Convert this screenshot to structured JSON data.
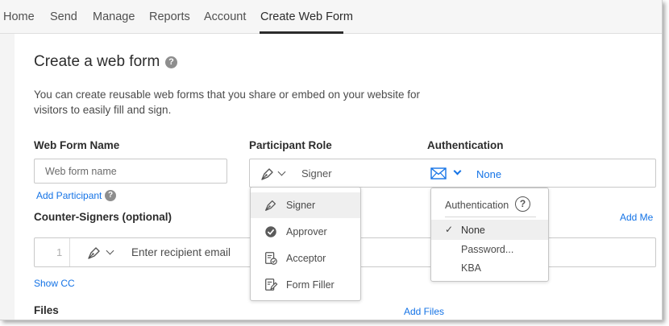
{
  "nav": {
    "items": [
      "Home",
      "Send",
      "Manage",
      "Reports",
      "Account",
      "Create Web Form"
    ],
    "active_index": 5
  },
  "page": {
    "title": "Create a web form",
    "description": "You can create reusable web forms that you share or embed on your website for visitors to easily fill and sign."
  },
  "form": {
    "web_form_name_label": "Web Form Name",
    "web_form_name_placeholder": "Web form name",
    "participant_role_label": "Participant Role",
    "participant_role_value": "Signer",
    "authentication_label": "Authentication",
    "authentication_value": "None",
    "add_participant": "Add Participant",
    "counter_signers_label": "Counter-Signers (optional)",
    "add_me": "Add Me",
    "recipient_index": "1",
    "recipient_placeholder": "Enter recipient email",
    "show_cc": "Show CC",
    "files_label": "Files",
    "add_files": "Add Files"
  },
  "role_menu": {
    "items": [
      {
        "label": "Signer",
        "icon": "pen-nib-icon",
        "highlighted": true
      },
      {
        "label": "Approver",
        "icon": "check-circle-icon",
        "highlighted": false
      },
      {
        "label": "Acceptor",
        "icon": "document-check-icon",
        "highlighted": false
      },
      {
        "label": "Form Filler",
        "icon": "form-edit-icon",
        "highlighted": false
      }
    ]
  },
  "auth_menu": {
    "header": "Authentication",
    "items": [
      {
        "label": "None",
        "selected": true
      },
      {
        "label": "Password...",
        "selected": false
      },
      {
        "label": "KBA",
        "selected": false
      }
    ]
  },
  "colors": {
    "link": "#1473e6",
    "text": "#2c2c2c",
    "muted": "#6b6b6b",
    "border": "#c9c9c9"
  }
}
